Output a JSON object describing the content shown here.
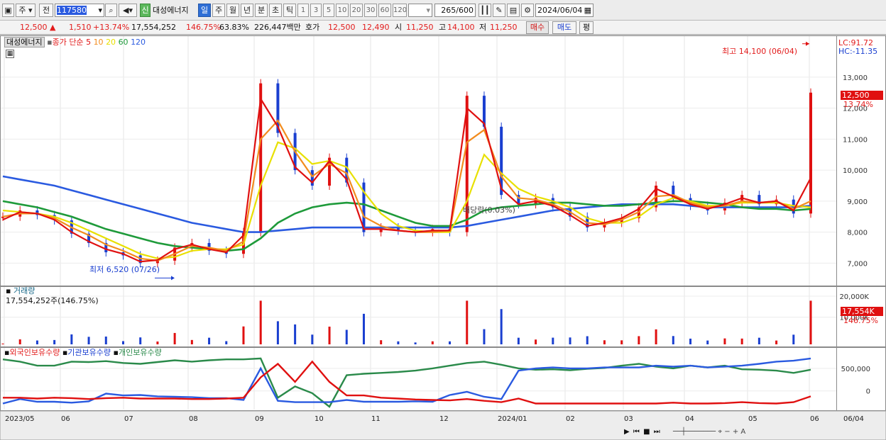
{
  "toolbar": {
    "period_type": "주",
    "period_type2": "전",
    "code": "117580",
    "name": "대성에너지",
    "credit": "신",
    "tf_day": "일",
    "tf_week": "주",
    "tf_month": "월",
    "tf_year": "년",
    "tf_min": "분",
    "tf_sec": "초",
    "tf_tick": "틱",
    "intervals": [
      "1",
      "3",
      "5",
      "10",
      "20",
      "30",
      "60",
      "120"
    ],
    "count": "265",
    "count_total": "/600",
    "date": "2024/06/04"
  },
  "quote": {
    "price": "12,500",
    "up_mark": "▲",
    "change": "1,510",
    "change_pct": "+13.74%",
    "volume": "17,554,252",
    "volume_ratio": "146.75%",
    "turnover": "63.83%",
    "amount": "226,447백만",
    "hoga_label": "호가",
    "hoga_ask": "12,500",
    "hoga_bid": "12,490",
    "open_label": "시",
    "open": "11,250",
    "high_label": "고",
    "high": "14,100",
    "low_label": "저",
    "low": "11,250",
    "buy": "매수",
    "sell": "매도",
    "avg": "평"
  },
  "legend": {
    "name": "대성에너지",
    "ma_label": "종가 단순",
    "ma_periods": [
      "5",
      "10",
      "20",
      "60",
      "120"
    ],
    "ma_colors": [
      "#e01010",
      "#f28c1e",
      "#e8e000",
      "#1e9a3a",
      "#2a5ae0"
    ]
  },
  "indicators": {
    "lc": "LC:91.72",
    "hc": "HC:-11.35",
    "price_tag": "12,500",
    "pct_tag": "13.74%",
    "vol_tag": "17,554K",
    "vol_pct_tag": "146.75%",
    "vol_title": "거래량",
    "vol_value": "17,554,252주(146.75%)"
  },
  "annotations": {
    "high_note": "최고 14,100 (06/04)",
    "low_note": "최저 6,520 (07/26)",
    "dividend": "배당락(0.03%)"
  },
  "holdings": {
    "foreign": "외국인보유수량",
    "inst": "기관보유수량",
    "indiv": "개인보유수량",
    "foreign_color": "#e01010",
    "inst_color": "#2a5ae0",
    "indiv_color": "#2a8a4a"
  },
  "axes": {
    "price_ticks": [
      "13,000",
      "12,000",
      "11,000",
      "10,000",
      "9,000",
      "8,000",
      "7,000"
    ],
    "vol_ticks": [
      "20,000K",
      "10,000K"
    ],
    "hold_ticks": [
      "500,000",
      "0"
    ],
    "x_labels": [
      "2023/05",
      "06",
      "07",
      "08",
      "09",
      "10",
      "11",
      "12",
      "2024/01",
      "02",
      "03",
      "04",
      "05",
      "06",
      "06/04"
    ]
  },
  "chart_data": {
    "type": "candlestick",
    "x_labels": [
      "2023/05",
      "06",
      "07",
      "08",
      "09",
      "10",
      "11",
      "12",
      "2024/01",
      "02",
      "03",
      "04",
      "05",
      "06"
    ],
    "price_range": [
      6300,
      14300
    ],
    "high": {
      "value": 14100,
      "date": "06/04"
    },
    "low": {
      "value": 6520,
      "date": "07/26"
    },
    "close": [
      8500,
      8700,
      8550,
      8380,
      7950,
      7650,
      7350,
      7250,
      7000,
      7080,
      7500,
      7650,
      7400,
      7300,
      8000,
      12800,
      11200,
      10000,
      9500,
      10400,
      9600,
      8000,
      8150,
      8050,
      8000,
      8100,
      8000,
      12400,
      11400,
      9200,
      8900,
      9100,
      8800,
      8500,
      8150,
      8300,
      8450,
      8800,
      9500,
      9100,
      8850,
      8700,
      8950,
      9200,
      8900,
      9050,
      8600,
      12500
    ],
    "ma": [
      {
        "name": "5",
        "values": [
          8400,
          8650,
          8600,
          8400,
          8000,
          7700,
          7450,
          7300,
          7050,
          7100,
          7450,
          7600,
          7450,
          7350,
          7900,
          12300,
          11400,
          10100,
          9600,
          10300,
          9700,
          8100,
          8100,
          8050,
          8000,
          8050,
          8050,
          12000,
          11500,
          9400,
          8900,
          9000,
          8850,
          8550,
          8200,
          8300,
          8450,
          8750,
          9400,
          9150,
          8900,
          8750,
          8900,
          9100,
          8950,
          9000,
          8700,
          9750
        ]
      },
      {
        "name": "10",
        "values": [
          8500,
          8600,
          8600,
          8450,
          8150,
          7900,
          7600,
          7400,
          7150,
          7080,
          7300,
          7550,
          7500,
          7400,
          7700,
          11000,
          11600,
          10600,
          9800,
          10200,
          9900,
          8500,
          8200,
          8050,
          8000,
          8000,
          8050,
          10900,
          11300,
          9800,
          9100,
          9050,
          8900,
          8650,
          8300,
          8250,
          8400,
          8650,
          9150,
          9200,
          8950,
          8800,
          8850,
          9000,
          8950,
          9000,
          8750,
          9000
        ]
      },
      {
        "name": "20",
        "values": [
          8700,
          8650,
          8600,
          8500,
          8300,
          8050,
          7800,
          7550,
          7300,
          7150,
          7200,
          7400,
          7450,
          7450,
          7600,
          9500,
          10900,
          10700,
          10200,
          10300,
          10100,
          9300,
          8600,
          8200,
          8050,
          8000,
          8000,
          9000,
          10500,
          9900,
          9400,
          9150,
          9000,
          8800,
          8450,
          8300,
          8300,
          8500,
          8900,
          9100,
          9000,
          8850,
          8850,
          8950,
          8950,
          8950,
          8850,
          8800
        ]
      },
      {
        "name": "60",
        "values": [
          9000,
          8900,
          8800,
          8650,
          8500,
          8300,
          8100,
          7950,
          7800,
          7650,
          7550,
          7500,
          7450,
          7400,
          7450,
          7800,
          8300,
          8600,
          8800,
          8900,
          8950,
          8900,
          8700,
          8500,
          8300,
          8200,
          8200,
          8400,
          8700,
          8800,
          8850,
          8900,
          8950,
          8950,
          8900,
          8850,
          8850,
          8900,
          8950,
          9000,
          9000,
          8950,
          8900,
          8800,
          8750,
          8750,
          8700,
          8750
        ]
      },
      {
        "name": "120",
        "values": [
          9800,
          9700,
          9600,
          9500,
          9350,
          9200,
          9050,
          8900,
          8750,
          8600,
          8450,
          8300,
          8200,
          8100,
          8000,
          8000,
          8050,
          8100,
          8150,
          8150,
          8150,
          8150,
          8150,
          8150,
          8150,
          8150,
          8150,
          8200,
          8300,
          8400,
          8500,
          8600,
          8700,
          8750,
          8800,
          8850,
          8900,
          8900,
          8900,
          8900,
          8850,
          8800,
          8800,
          8800,
          8800,
          8800,
          8800,
          8850
        ]
      }
    ],
    "volume_ticks_k": [
      20000,
      10000
    ],
    "holdings": [
      {
        "name": "외국인보유수량",
        "values": [
          -150000,
          -150000,
          -170000,
          -150000,
          -160000,
          -180000,
          -160000,
          -150000,
          -170000,
          -170000,
          -170000,
          -180000,
          -180000,
          -170000,
          -150000,
          300000,
          600000,
          200000,
          650000,
          200000,
          -100000,
          -100000,
          -150000,
          -170000,
          -190000,
          -200000,
          -210000,
          -180000,
          -220000,
          -250000,
          -170000,
          -280000,
          -280000,
          -280000,
          -280000,
          -280000,
          -280000,
          -280000,
          -280000,
          -260000,
          -280000,
          -280000,
          -270000,
          -250000,
          -270000,
          -280000,
          -250000,
          -120000
        ]
      },
      {
        "name": "기관보유수량",
        "values": [
          -280000,
          -180000,
          -240000,
          -240000,
          -260000,
          -230000,
          -60000,
          -100000,
          -90000,
          -120000,
          -130000,
          -140000,
          -160000,
          -160000,
          -200000,
          500000,
          -220000,
          -250000,
          -250000,
          -250000,
          -200000,
          -240000,
          -240000,
          -240000,
          -230000,
          -240000,
          -90000,
          -20000,
          -130000,
          -180000,
          450000,
          500000,
          520000,
          500000,
          500000,
          520000,
          520000,
          520000,
          560000,
          540000,
          560000,
          520000,
          540000,
          560000,
          600000,
          650000,
          670000,
          720000
        ]
      },
      {
        "name": "개인보유수량",
        "values": [
          700000,
          650000,
          560000,
          560000,
          650000,
          640000,
          660000,
          620000,
          600000,
          640000,
          680000,
          650000,
          680000,
          700000,
          700000,
          720000,
          -150000,
          100000,
          -50000,
          -350000,
          350000,
          380000,
          400000,
          420000,
          450000,
          500000,
          560000,
          620000,
          650000,
          580000,
          500000,
          470000,
          480000,
          460000,
          490000,
          510000,
          560000,
          600000,
          540000,
          500000,
          560000,
          520000,
          560000,
          480000,
          470000,
          450000,
          400000,
          470000
        ]
      }
    ]
  }
}
